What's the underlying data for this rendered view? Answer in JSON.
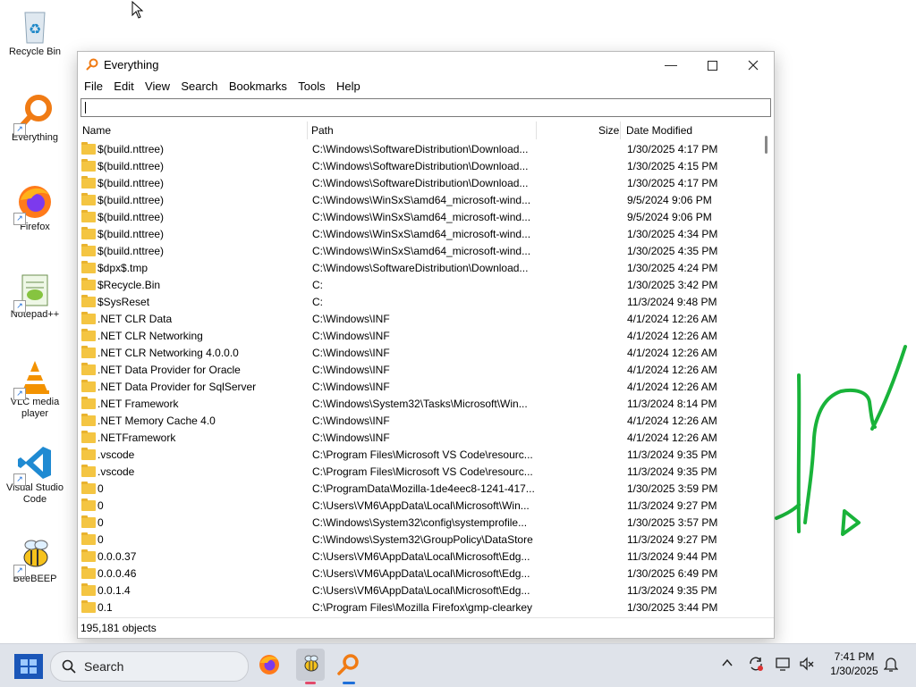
{
  "desktop": {
    "icons": [
      {
        "label": "Recycle Bin",
        "icon": "recycle-bin-icon"
      },
      {
        "label": "Everything",
        "icon": "everything-icon"
      },
      {
        "label": "Firefox",
        "icon": "firefox-icon"
      },
      {
        "label": "Notepad++",
        "icon": "notepad-plus-plus-icon"
      },
      {
        "label": "VLC media player",
        "icon": "vlc-icon"
      },
      {
        "label": "Visual Studio Code",
        "icon": "vscode-icon"
      },
      {
        "label": "BeeBEEP",
        "icon": "beebeep-icon"
      }
    ]
  },
  "window": {
    "title": "Everything",
    "menu": [
      "File",
      "Edit",
      "View",
      "Search",
      "Bookmarks",
      "Tools",
      "Help"
    ],
    "search_value": "",
    "columns": {
      "name": "Name",
      "path": "Path",
      "size": "Size",
      "date": "Date Modified"
    },
    "rows": [
      {
        "name": "$(build.nttree)",
        "path": "C:\\Windows\\SoftwareDistribution\\Download...",
        "date": "1/30/2025 4:17 PM"
      },
      {
        "name": "$(build.nttree)",
        "path": "C:\\Windows\\SoftwareDistribution\\Download...",
        "date": "1/30/2025 4:15 PM"
      },
      {
        "name": "$(build.nttree)",
        "path": "C:\\Windows\\SoftwareDistribution\\Download...",
        "date": "1/30/2025 4:17 PM"
      },
      {
        "name": "$(build.nttree)",
        "path": "C:\\Windows\\WinSxS\\amd64_microsoft-wind...",
        "date": "9/5/2024 9:06 PM"
      },
      {
        "name": "$(build.nttree)",
        "path": "C:\\Windows\\WinSxS\\amd64_microsoft-wind...",
        "date": "9/5/2024 9:06 PM"
      },
      {
        "name": "$(build.nttree)",
        "path": "C:\\Windows\\WinSxS\\amd64_microsoft-wind...",
        "date": "1/30/2025 4:34 PM"
      },
      {
        "name": "$(build.nttree)",
        "path": "C:\\Windows\\WinSxS\\amd64_microsoft-wind...",
        "date": "1/30/2025 4:35 PM"
      },
      {
        "name": "$dpx$.tmp",
        "path": "C:\\Windows\\SoftwareDistribution\\Download...",
        "date": "1/30/2025 4:24 PM"
      },
      {
        "name": "$Recycle.Bin",
        "path": "C:",
        "date": "1/30/2025 3:42 PM"
      },
      {
        "name": "$SysReset",
        "path": "C:",
        "date": "11/3/2024 9:48 PM"
      },
      {
        "name": ".NET CLR Data",
        "path": "C:\\Windows\\INF",
        "date": "4/1/2024 12:26 AM"
      },
      {
        "name": ".NET CLR Networking",
        "path": "C:\\Windows\\INF",
        "date": "4/1/2024 12:26 AM"
      },
      {
        "name": ".NET CLR Networking 4.0.0.0",
        "path": "C:\\Windows\\INF",
        "date": "4/1/2024 12:26 AM"
      },
      {
        "name": ".NET Data Provider for Oracle",
        "path": "C:\\Windows\\INF",
        "date": "4/1/2024 12:26 AM"
      },
      {
        "name": ".NET Data Provider for SqlServer",
        "path": "C:\\Windows\\INF",
        "date": "4/1/2024 12:26 AM"
      },
      {
        "name": ".NET Framework",
        "path": "C:\\Windows\\System32\\Tasks\\Microsoft\\Win...",
        "date": "11/3/2024 8:14 PM"
      },
      {
        "name": ".NET Memory Cache 4.0",
        "path": "C:\\Windows\\INF",
        "date": "4/1/2024 12:26 AM"
      },
      {
        "name": ".NETFramework",
        "path": "C:\\Windows\\INF",
        "date": "4/1/2024 12:26 AM"
      },
      {
        "name": ".vscode",
        "path": "C:\\Program Files\\Microsoft VS Code\\resourc...",
        "date": "11/3/2024 9:35 PM"
      },
      {
        "name": ".vscode",
        "path": "C:\\Program Files\\Microsoft VS Code\\resourc...",
        "date": "11/3/2024 9:35 PM"
      },
      {
        "name": "0",
        "path": "C:\\ProgramData\\Mozilla-1de4eec8-1241-417...",
        "date": "1/30/2025 3:59 PM"
      },
      {
        "name": "0",
        "path": "C:\\Users\\VM6\\AppData\\Local\\Microsoft\\Win...",
        "date": "11/3/2024 9:27 PM"
      },
      {
        "name": "0",
        "path": "C:\\Windows\\System32\\config\\systemprofile...",
        "date": "1/30/2025 3:57 PM"
      },
      {
        "name": "0",
        "path": "C:\\Windows\\System32\\GroupPolicy\\DataStore",
        "date": "11/3/2024 9:27 PM"
      },
      {
        "name": "0.0.0.37",
        "path": "C:\\Users\\VM6\\AppData\\Local\\Microsoft\\Edg...",
        "date": "11/3/2024 9:44 PM"
      },
      {
        "name": "0.0.0.46",
        "path": "C:\\Users\\VM6\\AppData\\Local\\Microsoft\\Edg...",
        "date": "1/30/2025 6:49 PM"
      },
      {
        "name": "0.0.1.4",
        "path": "C:\\Users\\VM6\\AppData\\Local\\Microsoft\\Edg...",
        "date": "11/3/2024 9:35 PM"
      },
      {
        "name": "0.1",
        "path": "C:\\Program Files\\Mozilla Firefox\\gmp-clearkey",
        "date": "1/30/2025 3:44 PM"
      }
    ],
    "status": "195,181 objects"
  },
  "taskbar": {
    "search_label": "Search",
    "time": "7:41 PM",
    "date": "1/30/2025",
    "apps": [
      "firefox-icon",
      "beebeep-icon",
      "everything-icon"
    ]
  },
  "colors": {
    "accent": "#1e6fd9",
    "drawing": "#19b33a",
    "folder": "#f4c542"
  }
}
